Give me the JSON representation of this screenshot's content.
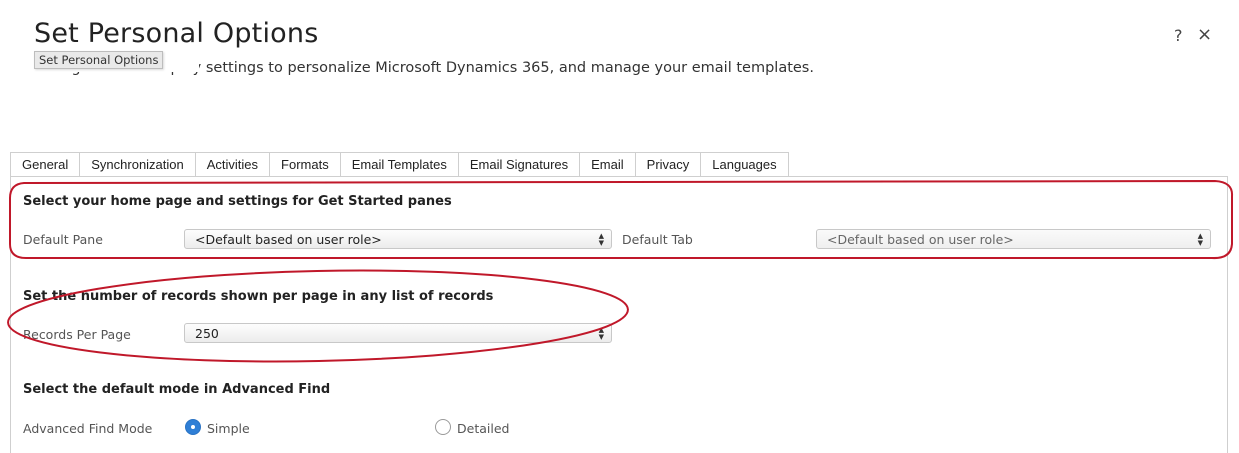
{
  "dialog": {
    "title": "Set Personal Options",
    "subtitle": "Change default display settings to personalize Microsoft Dynamics 365, and manage your email templates.",
    "tooltip": "Set Personal Options",
    "help_label": "?",
    "close_label": "×"
  },
  "tabs": [
    {
      "label": "General",
      "active": true
    },
    {
      "label": "Synchronization"
    },
    {
      "label": "Activities"
    },
    {
      "label": "Formats"
    },
    {
      "label": "Email Templates"
    },
    {
      "label": "Email Signatures"
    },
    {
      "label": "Email"
    },
    {
      "label": "Privacy"
    },
    {
      "label": "Languages"
    }
  ],
  "home_page": {
    "title": "Select your home page and settings for Get Started panes",
    "default_pane_label": "Default Pane",
    "default_pane_value": "<Default based on user role>",
    "default_tab_label": "Default Tab",
    "default_tab_value": "<Default based on user role>"
  },
  "records": {
    "title": "Set the number of records shown per page in any list of records",
    "label": "Records Per Page",
    "value": "250"
  },
  "advanced_find": {
    "title": "Select the default mode in Advanced Find",
    "label": "Advanced Find Mode",
    "option_simple": "Simple",
    "option_detailed": "Detailed",
    "selected": "Simple"
  },
  "colors": {
    "annotation": "#c0182a",
    "radio_selected": "#2f7fd6"
  }
}
